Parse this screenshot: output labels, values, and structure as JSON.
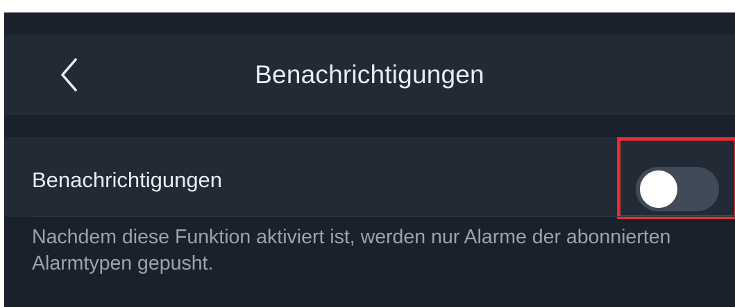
{
  "header": {
    "title": "Benachrichtigungen",
    "back_icon": "chevron-left-icon"
  },
  "settings": {
    "notifications_row": {
      "label": "Benachrichtigungen",
      "toggle_state": "off"
    },
    "description": "Nachdem diese Funktion aktiviert ist, werden nur Alarme der abonnierten Alarmtypen gepusht."
  },
  "colors": {
    "background": "#1a212c",
    "panel": "#222a35",
    "text_primary": "#e9edf2",
    "text_secondary": "#9aa3af",
    "toggle_track_off": "#414a57",
    "toggle_knob": "#ffffff",
    "highlight": "#e62d35"
  }
}
